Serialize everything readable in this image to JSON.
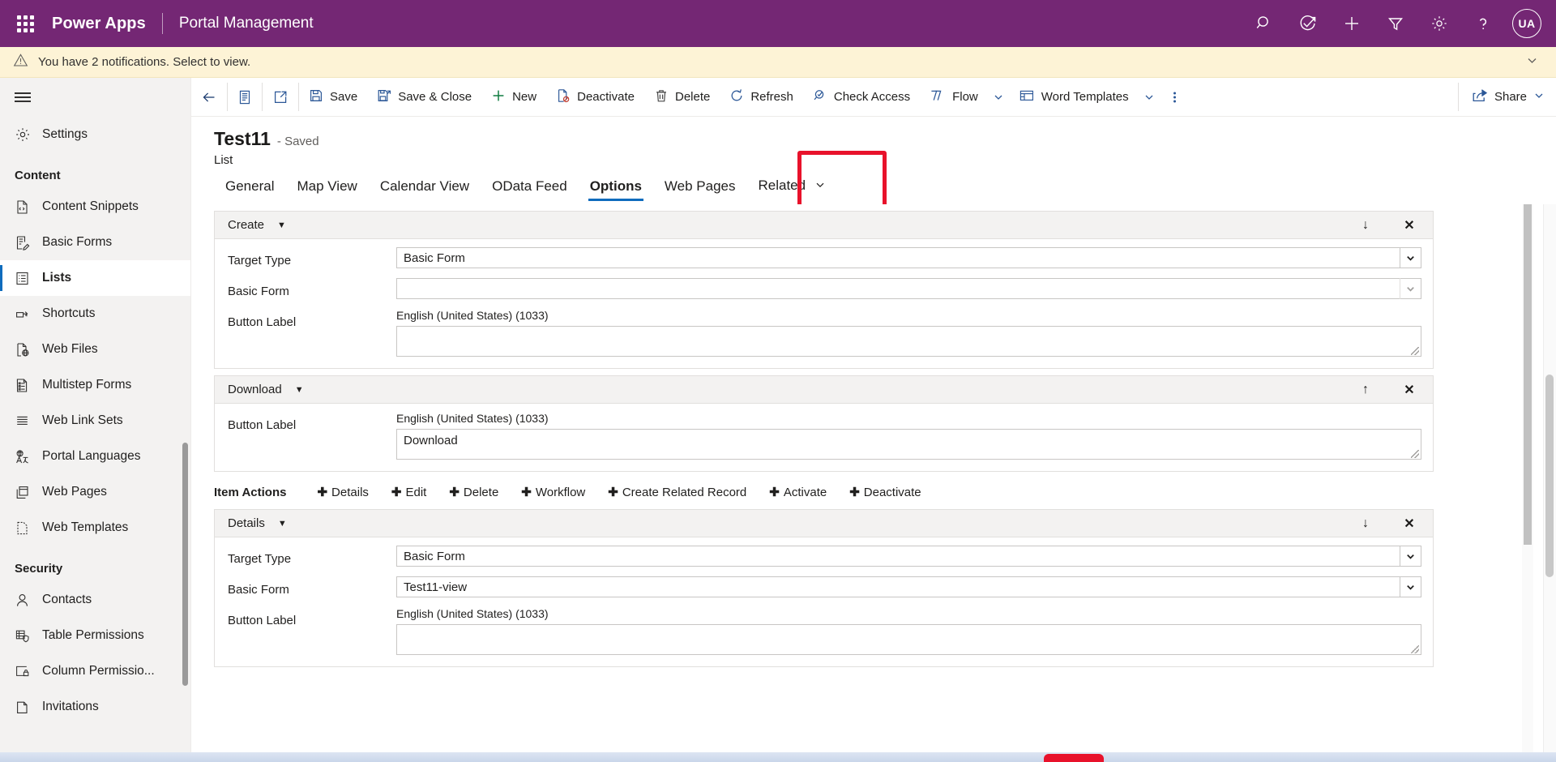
{
  "suite": {
    "waffle_icon": "waffle-icon",
    "brand": "Power Apps",
    "app_name": "Portal Management",
    "icons": [
      {
        "name": "search-icon",
        "label": "Search"
      },
      {
        "name": "check-circle-arrow-icon",
        "label": "Assistant"
      },
      {
        "name": "plus-icon",
        "label": "New"
      },
      {
        "name": "filter-icon",
        "label": "Filter"
      },
      {
        "name": "gear-icon",
        "label": "Settings"
      },
      {
        "name": "help-icon",
        "label": "?"
      }
    ],
    "avatar_initials": "UA",
    "brand_color": "#742774"
  },
  "notification": {
    "icon": "warning-icon",
    "text": "You have 2 notifications. Select to view.",
    "chevron": "chevron-down-icon",
    "background": "#fdf3d6"
  },
  "sidebar": {
    "hamburger": "hamburger-icon",
    "settings": {
      "label": "Settings",
      "icon": "gear-icon"
    },
    "groups": [
      {
        "title": "Content",
        "items": [
          {
            "label": "Content Snippets",
            "icon": "code-file-icon",
            "active": false
          },
          {
            "label": "Basic Forms",
            "icon": "form-edit-icon",
            "active": false
          },
          {
            "label": "Lists",
            "icon": "list-icon",
            "active": true
          },
          {
            "label": "Shortcuts",
            "icon": "shortcut-icon",
            "active": false
          },
          {
            "label": "Web Files",
            "icon": "web-file-icon",
            "active": false
          },
          {
            "label": "Multistep Forms",
            "icon": "multistep-form-icon",
            "active": false
          },
          {
            "label": "Web Link Sets",
            "icon": "link-set-icon",
            "active": false
          },
          {
            "label": "Portal Languages",
            "icon": "language-icon",
            "active": false
          },
          {
            "label": "Web Pages",
            "icon": "pages-icon",
            "active": false
          },
          {
            "label": "Web Templates",
            "icon": "template-icon",
            "active": false
          }
        ]
      },
      {
        "title": "Security",
        "items": [
          {
            "label": "Contacts",
            "icon": "person-icon",
            "active": false
          },
          {
            "label": "Table Permissions",
            "icon": "table-shield-icon",
            "active": false
          },
          {
            "label": "Column Permissio...",
            "icon": "column-lock-icon",
            "active": false
          },
          {
            "label": "Invitations",
            "icon": "invitation-icon",
            "active": false
          }
        ]
      }
    ]
  },
  "commandbar": {
    "back_icon": "back-arrow-icon",
    "form_icon": "form-icon",
    "popout_icon": "popout-icon",
    "buttons": [
      {
        "label": "Save",
        "icon": "save-icon"
      },
      {
        "label": "Save & Close",
        "icon": "save-close-icon"
      },
      {
        "label": "New",
        "icon": "plus-icon"
      },
      {
        "label": "Deactivate",
        "icon": "deactivate-icon"
      },
      {
        "label": "Delete",
        "icon": "trash-icon"
      },
      {
        "label": "Refresh",
        "icon": "refresh-icon"
      },
      {
        "label": "Check Access",
        "icon": "check-access-icon"
      },
      {
        "label": "Flow",
        "icon": "flow-icon",
        "caret": true
      },
      {
        "label": "Word Templates",
        "icon": "word-template-icon",
        "caret": true
      }
    ],
    "overflow_icon": "more-vertical-icon",
    "share": {
      "label": "Share",
      "icon": "share-icon",
      "caret": true
    }
  },
  "record": {
    "title": "Test11",
    "saved_status": "- Saved",
    "entity": "List"
  },
  "tabs": {
    "items": [
      {
        "label": "General",
        "selected": false
      },
      {
        "label": "Map View",
        "selected": false
      },
      {
        "label": "Calendar View",
        "selected": false
      },
      {
        "label": "OData Feed",
        "selected": false
      },
      {
        "label": "Options",
        "selected": true
      },
      {
        "label": "Web Pages",
        "selected": false
      },
      {
        "label": "Related",
        "selected": false,
        "caret": true
      }
    ],
    "highlight_color": "#e8122b"
  },
  "form": {
    "language_label": "English (United States) (1033)",
    "sections": [
      {
        "title": "Create",
        "caret_icon": "chevron-down-icon",
        "actions": [
          {
            "icon": "move-down-icon",
            "glyph": "↓"
          },
          {
            "icon": "close-icon",
            "glyph": "✕"
          }
        ],
        "fields": [
          {
            "type": "select",
            "label": "Target Type",
            "value": "Basic Form",
            "caret_enabled": true
          },
          {
            "type": "select",
            "label": "Basic Form",
            "value": "",
            "caret_enabled": false
          },
          {
            "type": "textarea",
            "label": "Button Label",
            "lang": "English (United States) (1033)",
            "value": ""
          }
        ]
      },
      {
        "title": "Download",
        "caret_icon": "chevron-down-icon",
        "actions": [
          {
            "icon": "move-up-icon",
            "glyph": "↑"
          },
          {
            "icon": "close-icon",
            "glyph": "✕"
          }
        ],
        "fields": [
          {
            "type": "textarea",
            "label": "Button Label",
            "lang": "English (United States) (1033)",
            "value": "Download"
          }
        ]
      }
    ],
    "item_actions": {
      "title": "Item Actions",
      "buttons": [
        {
          "label": "Details"
        },
        {
          "label": "Edit"
        },
        {
          "label": "Delete"
        },
        {
          "label": "Workflow"
        },
        {
          "label": "Create Related Record"
        },
        {
          "label": "Activate"
        },
        {
          "label": "Deactivate"
        }
      ]
    },
    "item_sections": [
      {
        "title": "Details",
        "caret_icon": "chevron-down-icon",
        "actions": [
          {
            "icon": "move-down-icon",
            "glyph": "↓"
          },
          {
            "icon": "close-icon",
            "glyph": "✕"
          }
        ],
        "fields": [
          {
            "type": "select",
            "label": "Target Type",
            "value": "Basic Form",
            "caret_enabled": true
          },
          {
            "type": "select",
            "label": "Basic Form",
            "value": "Test11-view",
            "caret_enabled": true
          },
          {
            "type": "textarea",
            "label": "Button Label",
            "lang": "English (United States) (1033)",
            "value": ""
          }
        ]
      }
    ]
  }
}
